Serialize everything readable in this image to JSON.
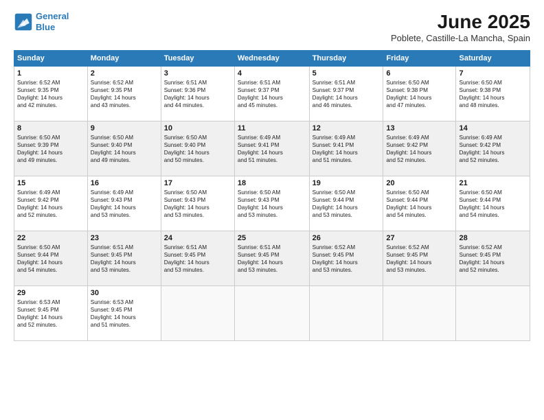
{
  "logo": {
    "line1": "General",
    "line2": "Blue"
  },
  "title": "June 2025",
  "location": "Poblete, Castille-La Mancha, Spain",
  "weekdays": [
    "Sunday",
    "Monday",
    "Tuesday",
    "Wednesday",
    "Thursday",
    "Friday",
    "Saturday"
  ],
  "weeks": [
    [
      {
        "day": "1",
        "rise": "6:52 AM",
        "set": "9:35 PM",
        "hours": "14",
        "mins": "42"
      },
      {
        "day": "2",
        "rise": "6:52 AM",
        "set": "9:35 PM",
        "hours": "14",
        "mins": "43"
      },
      {
        "day": "3",
        "rise": "6:51 AM",
        "set": "9:36 PM",
        "hours": "14",
        "mins": "44"
      },
      {
        "day": "4",
        "rise": "6:51 AM",
        "set": "9:37 PM",
        "hours": "14",
        "mins": "45"
      },
      {
        "day": "5",
        "rise": "6:51 AM",
        "set": "9:37 PM",
        "hours": "14",
        "mins": "46"
      },
      {
        "day": "6",
        "rise": "6:50 AM",
        "set": "9:38 PM",
        "hours": "14",
        "mins": "47"
      },
      {
        "day": "7",
        "rise": "6:50 AM",
        "set": "9:38 PM",
        "hours": "14",
        "mins": "48"
      }
    ],
    [
      {
        "day": "8",
        "rise": "6:50 AM",
        "set": "9:39 PM",
        "hours": "14",
        "mins": "49"
      },
      {
        "day": "9",
        "rise": "6:50 AM",
        "set": "9:40 PM",
        "hours": "14",
        "mins": "49"
      },
      {
        "day": "10",
        "rise": "6:50 AM",
        "set": "9:40 PM",
        "hours": "14",
        "mins": "50"
      },
      {
        "day": "11",
        "rise": "6:49 AM",
        "set": "9:41 PM",
        "hours": "14",
        "mins": "51"
      },
      {
        "day": "12",
        "rise": "6:49 AM",
        "set": "9:41 PM",
        "hours": "14",
        "mins": "51"
      },
      {
        "day": "13",
        "rise": "6:49 AM",
        "set": "9:42 PM",
        "hours": "14",
        "mins": "52"
      },
      {
        "day": "14",
        "rise": "6:49 AM",
        "set": "9:42 PM",
        "hours": "14",
        "mins": "52"
      }
    ],
    [
      {
        "day": "15",
        "rise": "6:49 AM",
        "set": "9:42 PM",
        "hours": "14",
        "mins": "52"
      },
      {
        "day": "16",
        "rise": "6:49 AM",
        "set": "9:43 PM",
        "hours": "14",
        "mins": "53"
      },
      {
        "day": "17",
        "rise": "6:50 AM",
        "set": "9:43 PM",
        "hours": "14",
        "mins": "53"
      },
      {
        "day": "18",
        "rise": "6:50 AM",
        "set": "9:43 PM",
        "hours": "14",
        "mins": "53"
      },
      {
        "day": "19",
        "rise": "6:50 AM",
        "set": "9:44 PM",
        "hours": "14",
        "mins": "53"
      },
      {
        "day": "20",
        "rise": "6:50 AM",
        "set": "9:44 PM",
        "hours": "14",
        "mins": "54"
      },
      {
        "day": "21",
        "rise": "6:50 AM",
        "set": "9:44 PM",
        "hours": "14",
        "mins": "54"
      }
    ],
    [
      {
        "day": "22",
        "rise": "6:50 AM",
        "set": "9:44 PM",
        "hours": "14",
        "mins": "54"
      },
      {
        "day": "23",
        "rise": "6:51 AM",
        "set": "9:45 PM",
        "hours": "14",
        "mins": "53"
      },
      {
        "day": "24",
        "rise": "6:51 AM",
        "set": "9:45 PM",
        "hours": "14",
        "mins": "53"
      },
      {
        "day": "25",
        "rise": "6:51 AM",
        "set": "9:45 PM",
        "hours": "14",
        "mins": "53"
      },
      {
        "day": "26",
        "rise": "6:52 AM",
        "set": "9:45 PM",
        "hours": "14",
        "mins": "53"
      },
      {
        "day": "27",
        "rise": "6:52 AM",
        "set": "9:45 PM",
        "hours": "14",
        "mins": "53"
      },
      {
        "day": "28",
        "rise": "6:52 AM",
        "set": "9:45 PM",
        "hours": "14",
        "mins": "52"
      }
    ],
    [
      {
        "day": "29",
        "rise": "6:53 AM",
        "set": "9:45 PM",
        "hours": "14",
        "mins": "52"
      },
      {
        "day": "30",
        "rise": "6:53 AM",
        "set": "9:45 PM",
        "hours": "14",
        "mins": "51"
      },
      null,
      null,
      null,
      null,
      null
    ]
  ]
}
